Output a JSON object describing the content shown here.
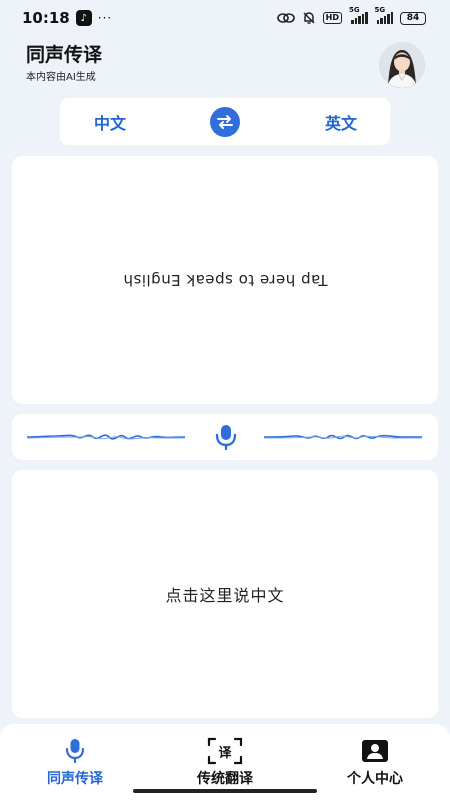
{
  "status": {
    "time": "10:18",
    "dots": "···",
    "hd": "HD",
    "net1": "5G",
    "net2": "5G",
    "battery": "84"
  },
  "header": {
    "title": "同声传译",
    "subtitle": "本内容由AI生成"
  },
  "lang": {
    "left": "中文",
    "right": "英文"
  },
  "cards": {
    "top_prompt": "Tap here to speak English",
    "bottom_prompt": "点击这里说中文"
  },
  "tabs": [
    {
      "label": "同声传译",
      "icon": "mic-icon",
      "active": true
    },
    {
      "label": "传统翻译",
      "icon": "translate-icon",
      "glyph": "译",
      "active": false
    },
    {
      "label": "个人中心",
      "icon": "profile-icon",
      "active": false
    }
  ],
  "colors": {
    "accent": "#2366d1",
    "background": "#eef2f9"
  }
}
